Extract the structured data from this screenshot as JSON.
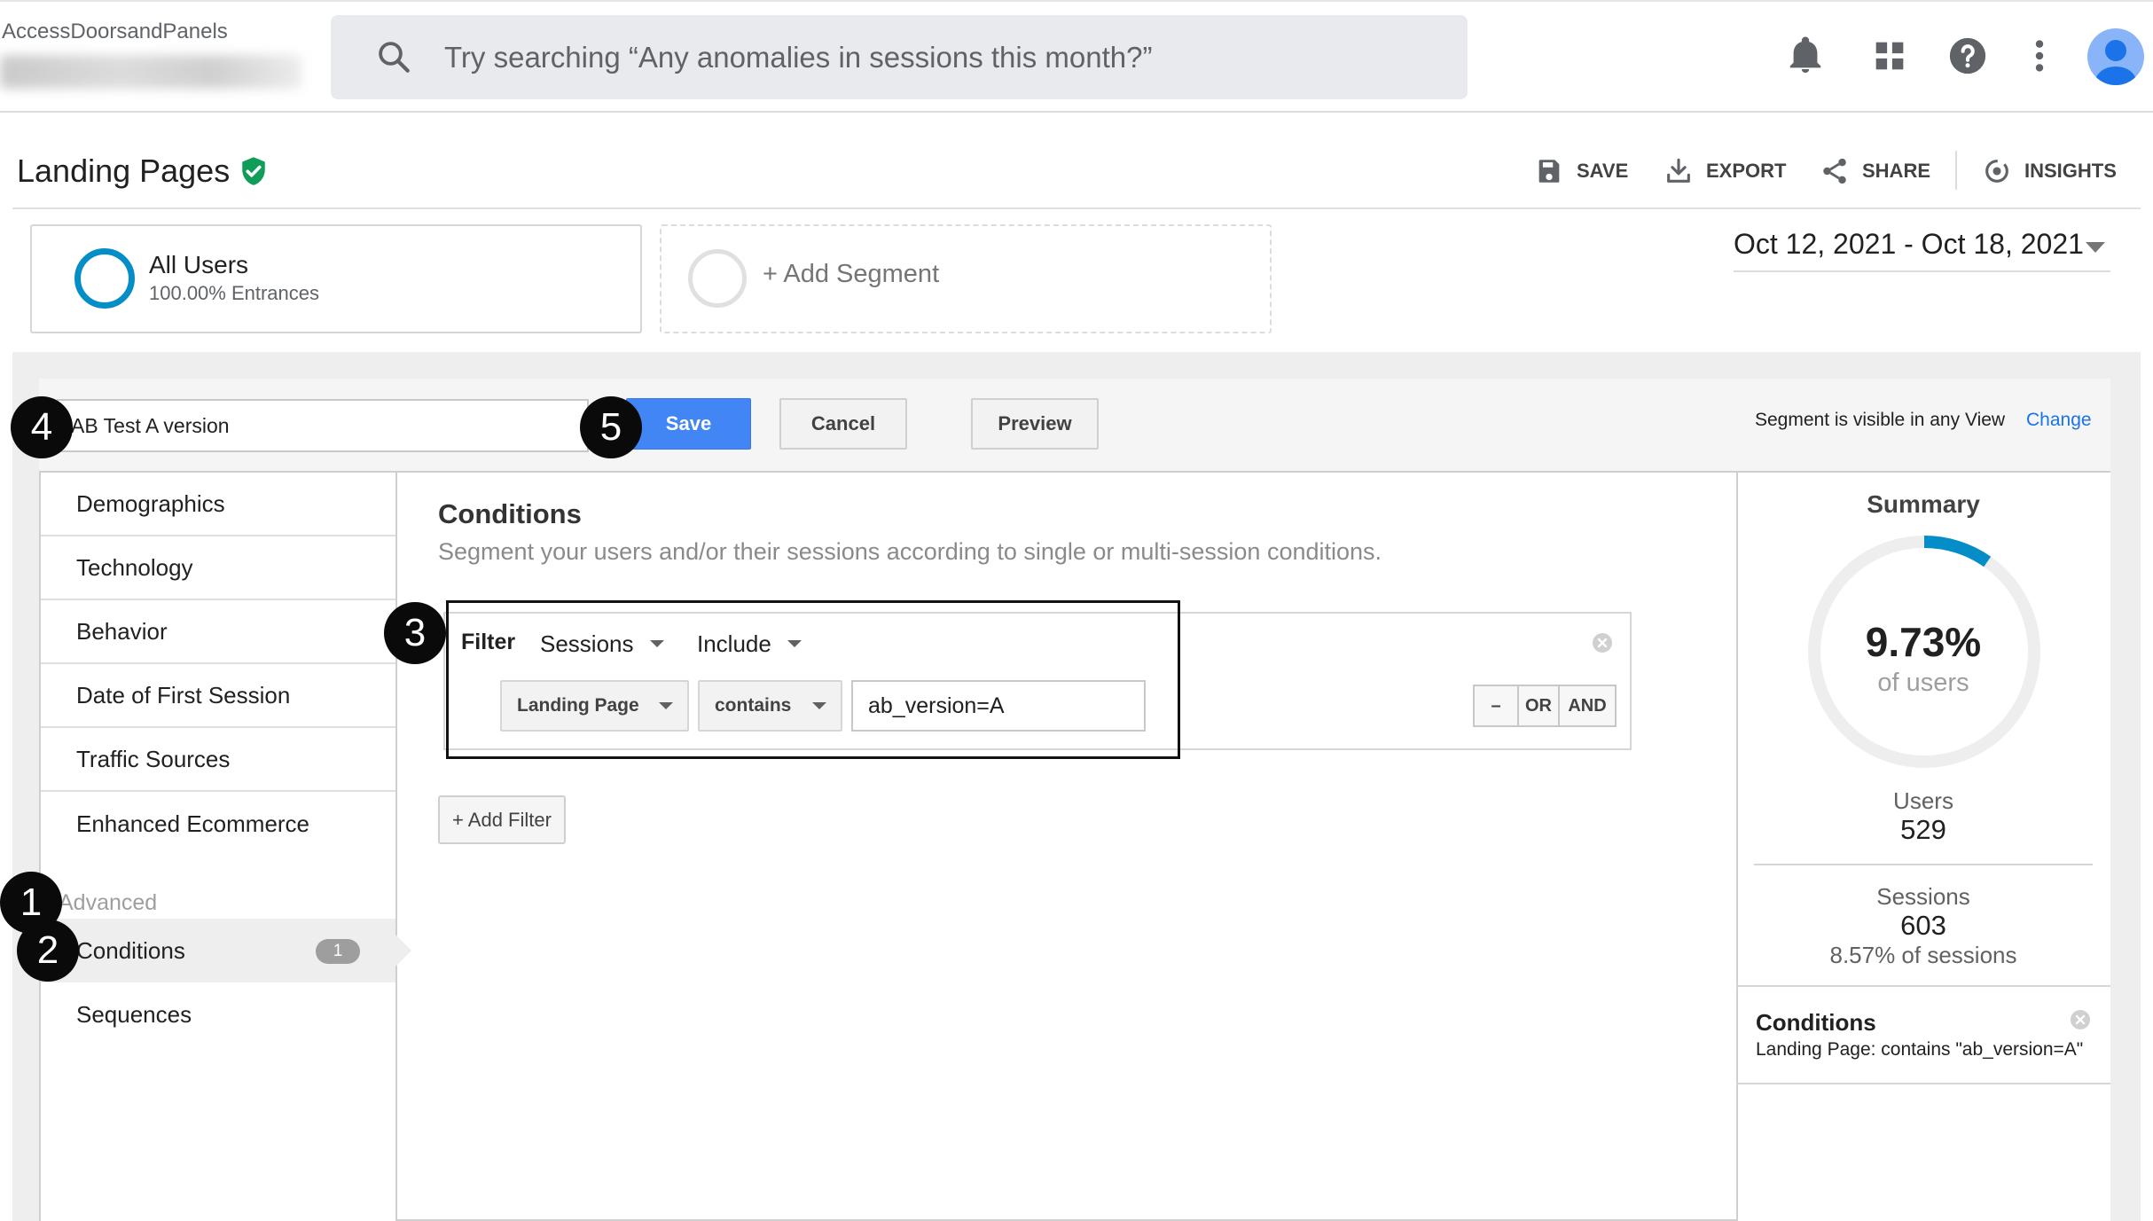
{
  "header": {
    "account_name": "AccessDoorsandPanels",
    "search_placeholder": "Try searching “Any anomalies in sessions this month?”",
    "icons": [
      "search-icon",
      "notifications-icon",
      "apps-grid-icon",
      "help-icon",
      "more-vert-icon",
      "account-avatar-icon"
    ]
  },
  "report": {
    "title": "Landing Pages",
    "actions": [
      {
        "label": "SAVE",
        "icon": "save-icon"
      },
      {
        "label": "EXPORT",
        "icon": "download-icon"
      },
      {
        "label": "SHARE",
        "icon": "share-icon"
      },
      {
        "label": "INSIGHTS",
        "icon": "insights-icon"
      }
    ],
    "date_range": "Oct 12, 2021 - Oct 18, 2021"
  },
  "segments": {
    "active": {
      "name": "All Users",
      "sub": "100.00% Entrances",
      "color": "#058dc7"
    },
    "add_label": "+ Add Segment"
  },
  "builder": {
    "segment_name": "AB Test A version",
    "save_label": "Save",
    "cancel_label": "Cancel",
    "preview_label": "Preview",
    "visibility_text": "Segment is visible in any View",
    "change_label": "Change"
  },
  "menu": {
    "items": [
      "Demographics",
      "Technology",
      "Behavior",
      "Date of First Session",
      "Traffic Sources",
      "Enhanced Ecommerce"
    ],
    "advanced_heading": "Advanced",
    "conditions_label": "Conditions",
    "conditions_count": "1",
    "sequences_label": "Sequences"
  },
  "conditions": {
    "title": "Conditions",
    "description": "Segment your users and/or their sessions according to single or multi-session conditions.",
    "filter_label": "Filter",
    "scope": "Sessions",
    "mode": "Include",
    "dimension": "Landing Page",
    "operator": "contains",
    "value": "ab_version=A",
    "ops": [
      "–",
      "OR",
      "AND"
    ],
    "add_filter_label": "+ Add Filter"
  },
  "summary": {
    "title": "Summary",
    "percent": "9.73%",
    "percent_value": 0.0973,
    "percent_sub": "of users",
    "users_label": "Users",
    "users_value": "529",
    "sessions_label": "Sessions",
    "sessions_value": "603",
    "sessions_pct": "8.57% of sessions",
    "conditions_title": "Conditions",
    "conditions_text": "Landing Page: contains \"ab_version=A\"",
    "gauge_color": "#058dc7"
  },
  "markers": [
    "1",
    "2",
    "3",
    "4",
    "5"
  ]
}
